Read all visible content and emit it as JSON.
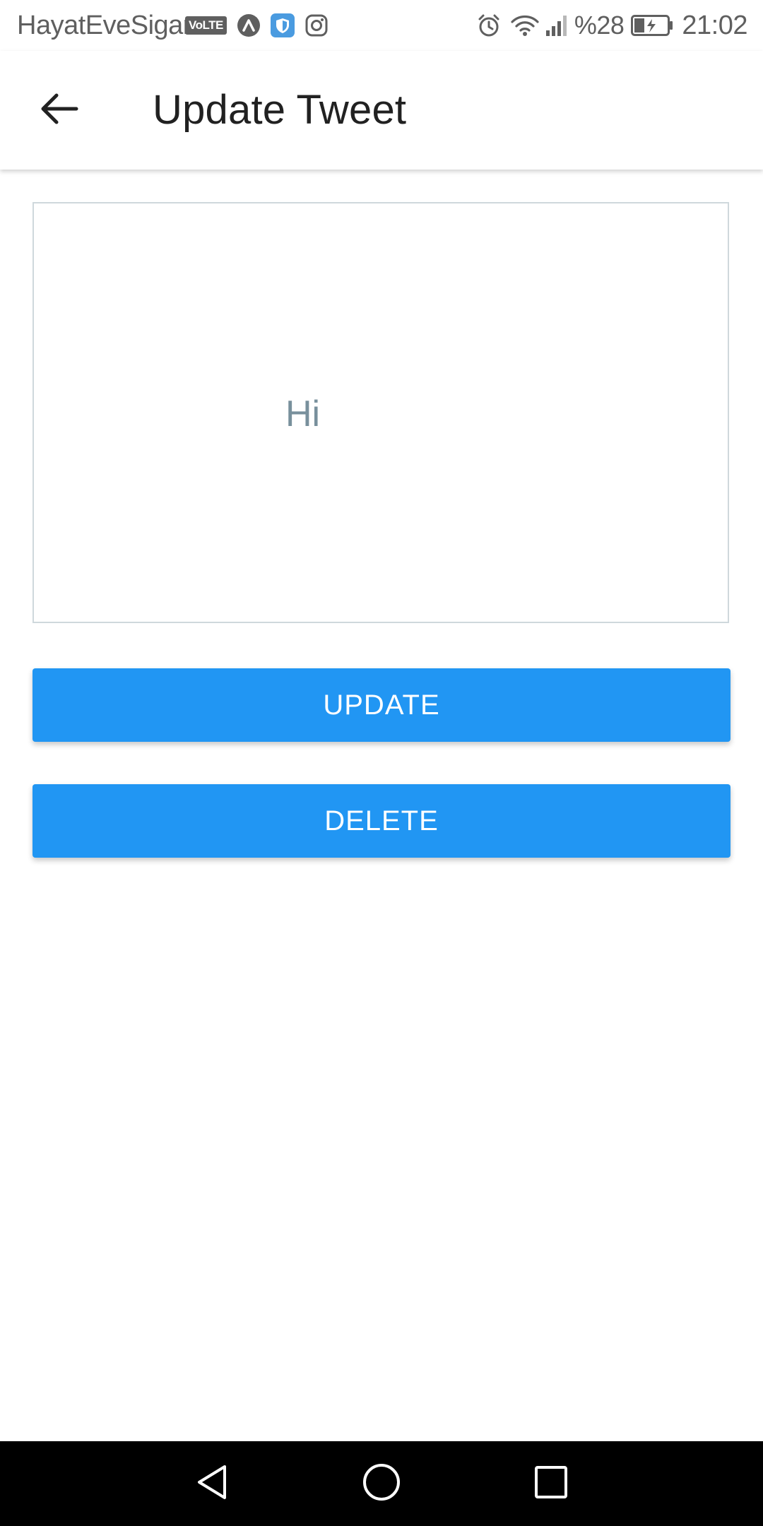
{
  "status_bar": {
    "carrier": "HayatEveSigar",
    "volte": "VoLTE",
    "battery_percent": "%28",
    "time": "21:02",
    "icons": [
      "volte-icon",
      "arc-icon",
      "shield-icon",
      "instagram-icon",
      "alarm-icon",
      "wifi-icon",
      "signal-icon",
      "battery-charging-icon"
    ]
  },
  "app_bar": {
    "title": "Update Tweet",
    "back_icon": "arrow-back-icon"
  },
  "tweet": {
    "text": "Hi",
    "border_color": "#cfd8dc",
    "text_color": "#78909c"
  },
  "actions": {
    "update_label": "UPDATE",
    "delete_label": "DELETE",
    "button_color": "#2196f3"
  },
  "nav_bar": {
    "icons": [
      "nav-back-icon",
      "nav-home-icon",
      "nav-recents-icon"
    ]
  }
}
